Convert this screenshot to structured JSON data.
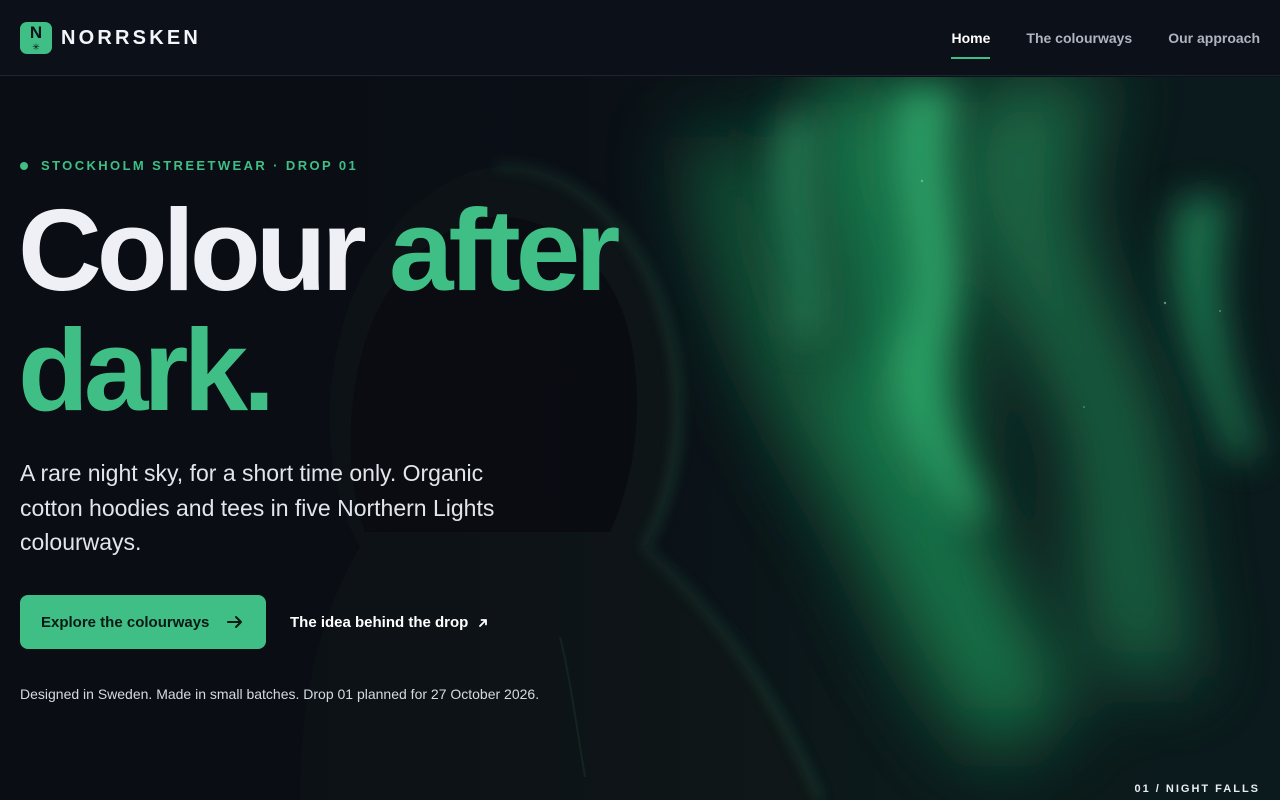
{
  "brand": {
    "logo_letter": "N",
    "logo_symbol": "✳",
    "name": "NORRSKEN"
  },
  "nav": {
    "items": [
      {
        "label": "Home",
        "active": true
      },
      {
        "label": "The colourways",
        "active": false
      },
      {
        "label": "Our approach",
        "active": false
      }
    ]
  },
  "hero": {
    "eyebrow": "STOCKHOLM STREETWEAR · DROP 01",
    "headline": {
      "word1": "Colour",
      "word2": "after",
      "word3": "dark."
    },
    "lede": "A rare night sky, for a short time only. Organic cotton hoodies and tees in five Northern Lights colourways.",
    "primary_cta": "Explore the colourways",
    "secondary_cta": "The idea behind the drop",
    "footnote": "Designed in Sweden. Made in small batches. Drop 01 planned for 27 October 2026.",
    "slide_label": "01 / NIGHT FALLS"
  },
  "colors": {
    "accent": "#3fbf86",
    "background": "#0b0f17",
    "text": "#eef0f5"
  },
  "icons": {
    "primary_cta": "arrow-right-icon",
    "secondary_cta": "arrow-up-right-icon",
    "eyebrow": "dot-icon"
  }
}
